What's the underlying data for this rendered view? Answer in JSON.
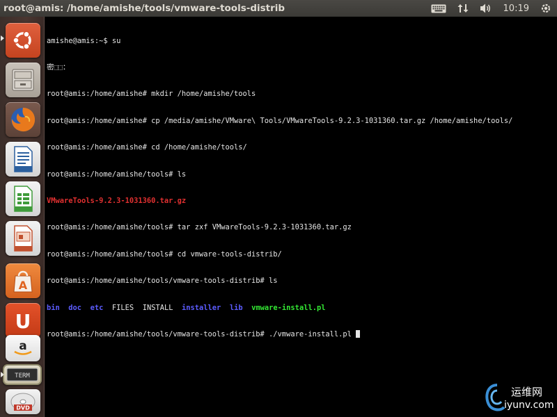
{
  "window": {
    "title": "root@amis: /home/amishe/tools/vmware-tools-distrib"
  },
  "tray": {
    "keyboard_icon": "keyboard-icon",
    "network_icon": "network-updown-icon",
    "volume_icon": "volume-icon",
    "clock": "10:19",
    "power_icon": "gear-power-icon"
  },
  "launcher": {
    "items": [
      {
        "name": "dash-home",
        "icon": "ubuntu-logo-icon"
      },
      {
        "name": "files",
        "icon": "file-cabinet-icon"
      },
      {
        "name": "firefox",
        "icon": "firefox-icon"
      },
      {
        "name": "libreoffice-writer",
        "icon": "writer-document-icon"
      },
      {
        "name": "libreoffice-calc",
        "icon": "calc-spreadsheet-icon"
      },
      {
        "name": "libreoffice-impress",
        "icon": "impress-presentation-icon"
      },
      {
        "name": "software-center",
        "icon": "shopping-bag-icon"
      },
      {
        "name": "ubuntu-one",
        "icon": "ubuntu-one-icon"
      },
      {
        "name": "amazon",
        "icon": "amazon-icon"
      },
      {
        "name": "terminal",
        "icon": "terminal-icon",
        "label": "TERM"
      },
      {
        "name": "dvd",
        "icon": "dvd-icon",
        "label": "DVD"
      }
    ]
  },
  "terminal": {
    "lines": [
      "amishe@amis:~$ su",
      "密⬚⬚：",
      "root@amis:/home/amishe# mkdir /home/amishe/tools",
      "root@amis:/home/amishe# cp /media/amishe/VMware\\ Tools/VMwareTools-9.2.3-1031360.tar.gz /home/amishe/tools/",
      "root@amis:/home/amishe# cd /home/amishe/tools/",
      "root@amis:/home/amishe/tools# ls",
      "VMwareTools-9.2.3-1031360.tar.gz",
      "root@amis:/home/amishe/tools# tar zxf VMwareTools-9.2.3-1031360.tar.gz",
      "root@amis:/home/amishe/tools# cd vmware-tools-distrib/",
      "root@amis:/home/amishe/tools/vmware-tools-distrib# ls"
    ],
    "ls_output": [
      {
        "text": "bin",
        "type": "dir"
      },
      {
        "text": "doc",
        "type": "dir"
      },
      {
        "text": "etc",
        "type": "dir"
      },
      {
        "text": "FILES",
        "type": "file"
      },
      {
        "text": "INSTALL",
        "type": "file"
      },
      {
        "text": "installer",
        "type": "dir"
      },
      {
        "text": "lib",
        "type": "dir"
      },
      {
        "text": "vmware-install.pl",
        "type": "exec"
      }
    ],
    "prompt_line": "root@amis:/home/amishe/tools/vmware-tools-distrib# ./vmware-install.pl "
  },
  "colors": {
    "dir": "#5c5cff",
    "exec": "#33e633",
    "archive": "#e03030",
    "text": "#e6e6e6"
  },
  "watermark": {
    "cn": "运维网",
    "url": "iyunv.com"
  }
}
